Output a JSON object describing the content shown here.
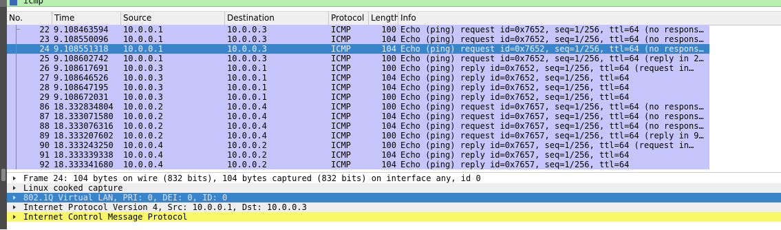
{
  "filter": {
    "text": "icmp"
  },
  "columns": [
    "No.",
    "Time",
    "Source",
    "Destination",
    "Protocol",
    "Length",
    "Info"
  ],
  "packets": [
    {
      "no": "22",
      "time": "9.108463594",
      "src": "10.0.0.1",
      "dst": "10.0.0.3",
      "proto": "ICMP",
      "len": "100",
      "info": "Echo (ping) request  id=0x7652, seq=1/256, ttl=64 (no respons…"
    },
    {
      "no": "23",
      "time": "9.108550096",
      "src": "10.0.0.1",
      "dst": "10.0.0.3",
      "proto": "ICMP",
      "len": "104",
      "info": "Echo (ping) request  id=0x7652, seq=1/256, ttl=64 (no respons…"
    },
    {
      "no": "24",
      "time": "9.108551318",
      "src": "10.0.0.1",
      "dst": "10.0.0.3",
      "proto": "ICMP",
      "len": "104",
      "info": "Echo (ping) request  id=0x7652, seq=1/256, ttl=64 (no respons…",
      "selected": true
    },
    {
      "no": "25",
      "time": "9.108602742",
      "src": "10.0.0.1",
      "dst": "10.0.0.3",
      "proto": "ICMP",
      "len": "100",
      "info": "Echo (ping) request  id=0x7652, seq=1/256, ttl=64 (reply in 2…"
    },
    {
      "no": "26",
      "time": "9.108617691",
      "src": "10.0.0.3",
      "dst": "10.0.0.1",
      "proto": "ICMP",
      "len": "100",
      "info": "Echo (ping) reply    id=0x7652, seq=1/256, ttl=64 (request in…"
    },
    {
      "no": "27",
      "time": "9.108646526",
      "src": "10.0.0.3",
      "dst": "10.0.0.1",
      "proto": "ICMP",
      "len": "104",
      "info": "Echo (ping) reply    id=0x7652, seq=1/256, ttl=64"
    },
    {
      "no": "28",
      "time": "9.108647195",
      "src": "10.0.0.3",
      "dst": "10.0.0.1",
      "proto": "ICMP",
      "len": "104",
      "info": "Echo (ping) reply    id=0x7652, seq=1/256, ttl=64"
    },
    {
      "no": "29",
      "time": "9.108672031",
      "src": "10.0.0.3",
      "dst": "10.0.0.1",
      "proto": "ICMP",
      "len": "100",
      "info": "Echo (ping) reply    id=0x7652, seq=1/256, ttl=64"
    },
    {
      "no": "86",
      "time": "18.332834804",
      "src": "10.0.0.2",
      "dst": "10.0.0.4",
      "proto": "ICMP",
      "len": "100",
      "info": "Echo (ping) request  id=0x7657, seq=1/256, ttl=64 (no respons…"
    },
    {
      "no": "87",
      "time": "18.333071580",
      "src": "10.0.0.2",
      "dst": "10.0.0.4",
      "proto": "ICMP",
      "len": "104",
      "info": "Echo (ping) request  id=0x7657, seq=1/256, ttl=64 (no respons…"
    },
    {
      "no": "88",
      "time": "18.333076316",
      "src": "10.0.0.2",
      "dst": "10.0.0.4",
      "proto": "ICMP",
      "len": "104",
      "info": "Echo (ping) request  id=0x7657, seq=1/256, ttl=64 (no respons…"
    },
    {
      "no": "89",
      "time": "18.333207602",
      "src": "10.0.0.2",
      "dst": "10.0.0.4",
      "proto": "ICMP",
      "len": "100",
      "info": "Echo (ping) request  id=0x7657, seq=1/256, ttl=64 (reply in 9…"
    },
    {
      "no": "90",
      "time": "18.333243250",
      "src": "10.0.0.4",
      "dst": "10.0.0.2",
      "proto": "ICMP",
      "len": "100",
      "info": "Echo (ping) reply    id=0x7657, seq=1/256, ttl=64 (request in…"
    },
    {
      "no": "91",
      "time": "18.333339338",
      "src": "10.0.0.4",
      "dst": "10.0.0.2",
      "proto": "ICMP",
      "len": "104",
      "info": "Echo (ping) reply    id=0x7657, seq=1/256, ttl=64"
    },
    {
      "no": "92",
      "time": "18.333341680",
      "src": "10.0.0.4",
      "dst": "10.0.0.2",
      "proto": "ICMP",
      "len": "104",
      "info": "Echo (ping) reply    id=0x7657, seq=1/256, ttl=64"
    }
  ],
  "details": [
    {
      "text": "Frame 24: 104 bytes on wire (832 bits), 104 bytes captured (832 bits) on interface any, id 0",
      "style": ""
    },
    {
      "text": "Linux cooked capture",
      "style": "alt"
    },
    {
      "text": "802.1Q Virtual LAN, PRI: 0, DEI: 0, ID: 0",
      "style": "sel"
    },
    {
      "text": "Internet Protocol Version 4, Src: 10.0.0.1, Dst: 10.0.0.3",
      "style": "alt"
    },
    {
      "text": "Internet Control Message Protocol",
      "style": "yel"
    }
  ],
  "colors": {
    "row_bg": "#c6c6fc",
    "selected_bg": "#3a84c9",
    "highlight_bg": "#f8f86a",
    "filter_bg": "#b9f0b0"
  }
}
